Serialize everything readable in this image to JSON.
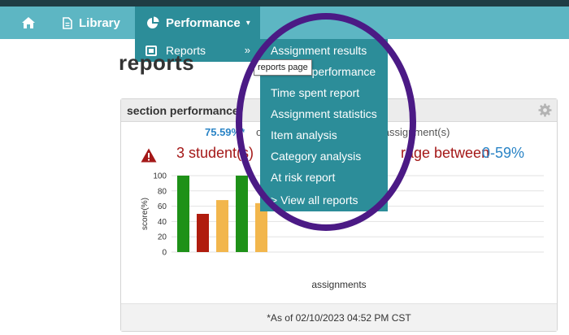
{
  "navbar": {
    "home_icon": "home-icon",
    "library": {
      "label": "Library",
      "icon": "document-icon"
    },
    "performance": {
      "label": "Performance",
      "icon": "pie-chart-icon",
      "caret": "▾"
    }
  },
  "submenu": {
    "label": "Reports",
    "icon": "report-icon",
    "arrow": "»"
  },
  "page": {
    "title": "reports"
  },
  "dropdown": {
    "items": [
      {
        "label": "Assignment results"
      },
      {
        "label": "Section performance"
      },
      {
        "label": "Time spent report"
      },
      {
        "label": "Assignment statistics"
      },
      {
        "label": "Item analysis"
      },
      {
        "label": "Category analysis"
      },
      {
        "label": "At risk report"
      },
      {
        "label": "> View all reports"
      }
    ]
  },
  "tooltip": {
    "text": "reports page"
  },
  "card": {
    "title": "section performance",
    "settings_icon": "gear-icon",
    "average_text": "75.59%*",
    "average_suffix": "o",
    "count_text": "r 5 assignment(s)",
    "warning_icon": "warning-icon",
    "warning_text_1": "3 student(s)",
    "warning_text_2": "rage between",
    "warning_range": "0-59%",
    "footer": "*As of 02/10/2023 04:52 PM CST"
  },
  "chart_data": {
    "type": "bar",
    "xlabel": "assignments",
    "ylabel": "score(%)",
    "ylim": [
      0,
      100
    ],
    "yticks": [
      "100",
      "80",
      "60",
      "40",
      "20",
      "0"
    ],
    "values": [
      100,
      50,
      68,
      100,
      64
    ],
    "colors": [
      "#1e9118",
      "#b01c0e",
      "#f2b64c",
      "#1e9118",
      "#f2b64c"
    ],
    "grid": true
  }
}
